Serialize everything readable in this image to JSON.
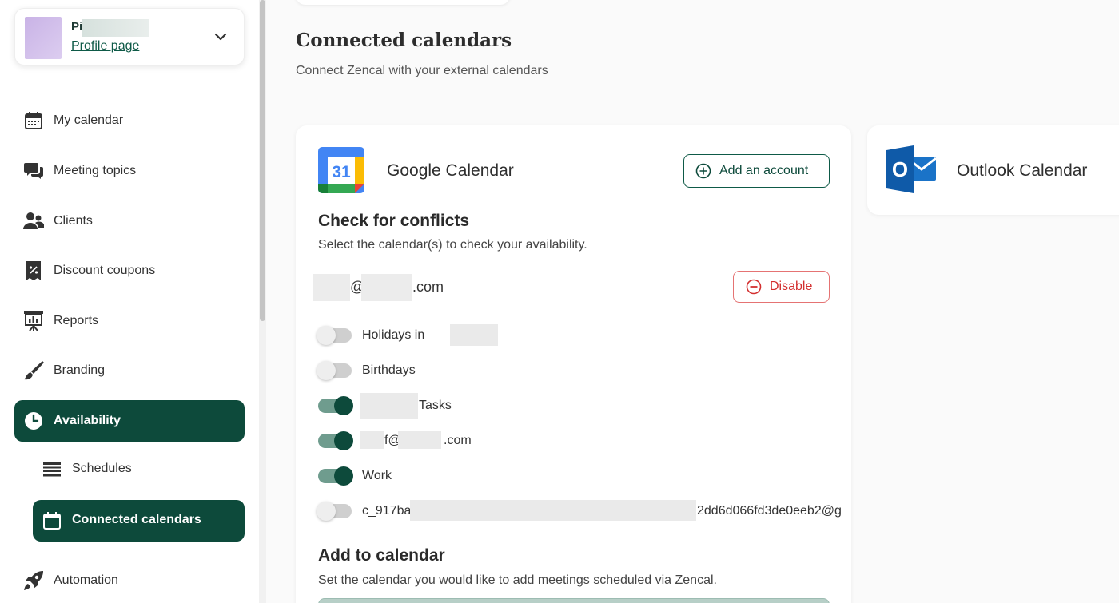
{
  "profile": {
    "name_visible": "Pi",
    "link": "Profile page"
  },
  "sidebar": {
    "items": [
      {
        "label": "My calendar",
        "icon": "calendar-icon"
      },
      {
        "label": "Meeting topics",
        "icon": "chat-bubbles-icon"
      },
      {
        "label": "Clients",
        "icon": "people-icon"
      },
      {
        "label": "Discount coupons",
        "icon": "coupon-icon"
      },
      {
        "label": "Reports",
        "icon": "presentation-chart-icon"
      },
      {
        "label": "Branding",
        "icon": "paintbrush-icon"
      },
      {
        "label": "Availability",
        "icon": "clock-icon",
        "active": true
      },
      {
        "label": "Automation",
        "icon": "rocket-icon"
      }
    ],
    "sub_items": [
      {
        "label": "Schedules",
        "icon": "list-icon"
      },
      {
        "label": "Connected calendars",
        "icon": "calendar-icon",
        "active": true
      }
    ]
  },
  "page": {
    "title": "Connected calendars",
    "subtitle": "Connect Zencal with your external calendars"
  },
  "google": {
    "name": "Google Calendar",
    "logo_text": "31",
    "add_account_label": "Add an account",
    "conflicts_title": "Check for conflicts",
    "conflicts_desc": "Select the calendar(s) to check your availability.",
    "account_at": "@",
    "account_domain": ".com",
    "disable_label": "Disable",
    "calendars": [
      {
        "label": "Holidays in",
        "on": false
      },
      {
        "label": "Birthdays",
        "on": false
      },
      {
        "label": "Tasks",
        "on": true
      },
      {
        "label_start": "f@",
        "label_end": ".com",
        "on": true
      },
      {
        "label": "Work",
        "on": true
      },
      {
        "label_start": "c_917ba",
        "label_end": "2dd6d066fd3de0eeb2@g",
        "on": false
      }
    ],
    "add_title": "Add to calendar",
    "add_desc": "Set the calendar you would like to add meetings scheduled via Zencal."
  },
  "outlook": {
    "name": "Outlook Calendar",
    "logo_text": "O"
  },
  "colors": {
    "accent": "#0d4a3b",
    "danger": "#d32f2f",
    "toggle_track_on": "#6f9c8e"
  }
}
